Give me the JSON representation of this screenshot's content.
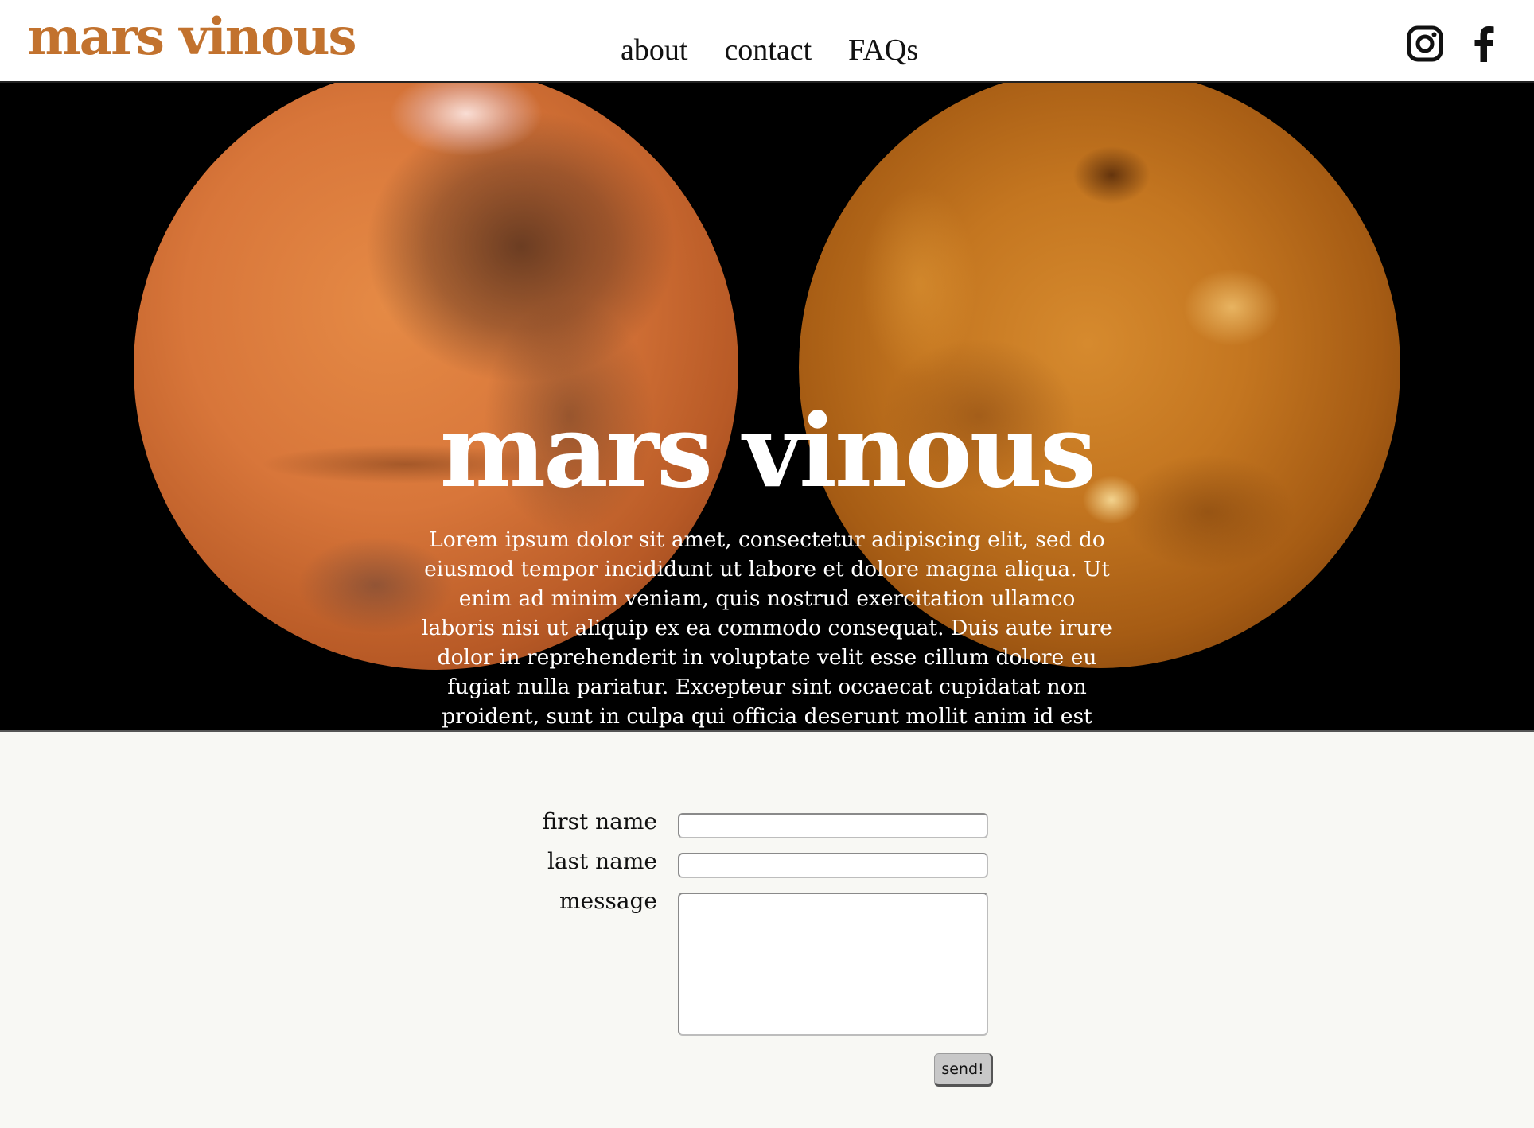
{
  "header": {
    "brand": "mars vinous",
    "nav": [
      {
        "label": "about"
      },
      {
        "label": "contact"
      },
      {
        "label": "FAQs"
      }
    ],
    "social": [
      {
        "icon": "instagram-icon"
      },
      {
        "icon": "facebook-icon"
      }
    ]
  },
  "hero": {
    "title": "mars vinous",
    "body": "Lorem ipsum dolor sit amet, consectetur adipiscing elit, sed do eiusmod tempor incididunt ut labore et dolore magna aliqua. Ut enim ad minim veniam, quis nostrud exercitation ullamco laboris nisi ut aliquip ex ea commodo consequat. Duis aute irure dolor in reprehenderit in voluptate velit esse cillum dolore eu fugiat nulla pariatur. Excepteur sint occaecat cupidatat non proident, sunt in culpa qui officia deserunt mollit anim id est laborum",
    "images": [
      "mars",
      "venus"
    ]
  },
  "form": {
    "first_name_label": "first name",
    "first_name_value": "",
    "last_name_label": "last name",
    "last_name_value": "",
    "message_label": "message",
    "message_value": "",
    "submit_label": "send!"
  },
  "colors": {
    "brand": "#c2722e",
    "hero_bg": "#000000",
    "page_bg": "#f8f8f4"
  }
}
